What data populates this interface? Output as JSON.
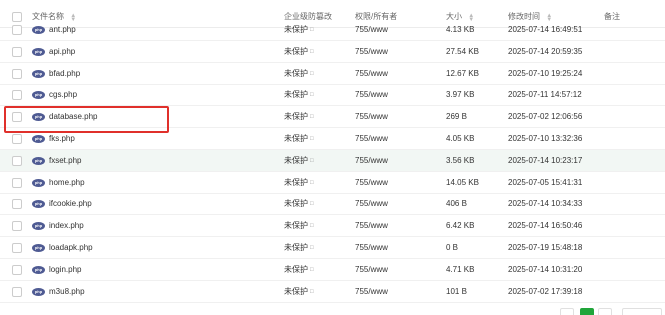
{
  "columns": {
    "name": "文件名称",
    "protection": "企业级防篡改",
    "permission": "权限/所有者",
    "size": "大小",
    "modified": "修改时间",
    "note": "备注"
  },
  "icons": {
    "php": "php-file-icon",
    "lock": "lock-icon",
    "sort": "sort-icon"
  },
  "colors": {
    "highlight_row": "#f2f7f4",
    "mark_border": "#e0302b",
    "php_badge": "#4f5b93",
    "active_page": "#20a53a"
  },
  "files": [
    {
      "name": "ant.php",
      "protection": "未保护",
      "permission": "755/www",
      "size": "4.13 KB",
      "modified": "2025-07-14 16:49:51"
    },
    {
      "name": "api.php",
      "protection": "未保护",
      "permission": "755/www",
      "size": "27.54 KB",
      "modified": "2025-07-14 20:59:35"
    },
    {
      "name": "bfad.php",
      "protection": "未保护",
      "permission": "755/www",
      "size": "12.67 KB",
      "modified": "2025-07-10 19:25:24"
    },
    {
      "name": "cgs.php",
      "protection": "未保护",
      "permission": "755/www",
      "size": "3.97 KB",
      "modified": "2025-07-11 14:57:12"
    },
    {
      "name": "database.php",
      "protection": "未保护",
      "permission": "755/www",
      "size": "269 B",
      "modified": "2025-07-02 12:06:56"
    },
    {
      "name": "fks.php",
      "protection": "未保护",
      "permission": "755/www",
      "size": "4.05 KB",
      "modified": "2025-07-10 13:32:36"
    },
    {
      "name": "fxset.php",
      "protection": "未保护",
      "permission": "755/www",
      "size": "3.56 KB",
      "modified": "2025-07-14 10:23:17"
    },
    {
      "name": "home.php",
      "protection": "未保护",
      "permission": "755/www",
      "size": "14.05 KB",
      "modified": "2025-07-05 15:41:31"
    },
    {
      "name": "ifcookie.php",
      "protection": "未保护",
      "permission": "755/www",
      "size": "406 B",
      "modified": "2025-07-14 10:34:33"
    },
    {
      "name": "index.php",
      "protection": "未保护",
      "permission": "755/www",
      "size": "6.42 KB",
      "modified": "2025-07-14 16:50:46"
    },
    {
      "name": "loadapk.php",
      "protection": "未保护",
      "permission": "755/www",
      "size": "0 B",
      "modified": "2025-07-19 15:48:18"
    },
    {
      "name": "login.php",
      "protection": "未保护",
      "permission": "755/www",
      "size": "4.71 KB",
      "modified": "2025-07-14 10:31:20"
    },
    {
      "name": "m3u8.php",
      "protection": "未保护",
      "permission": "755/www",
      "size": "101 B",
      "modified": "2025-07-02 17:39:18"
    }
  ]
}
